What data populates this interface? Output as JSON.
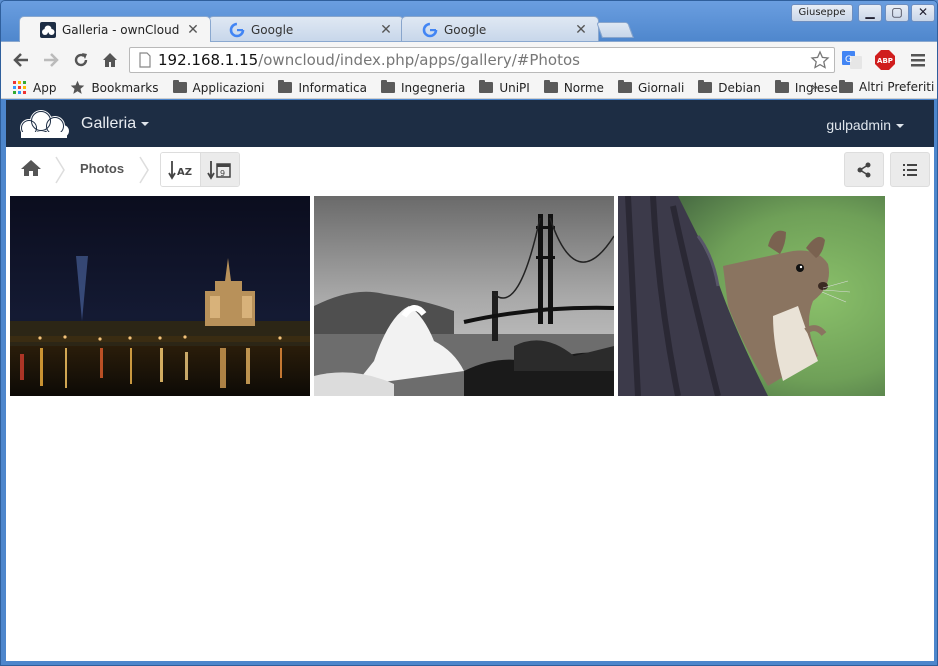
{
  "browser": {
    "tabs": [
      {
        "title": "Galleria - ownCloud",
        "active": true
      },
      {
        "title": "Google",
        "active": false
      },
      {
        "title": "Google",
        "active": false
      }
    ],
    "profile": "Giuseppe",
    "url_host": "192.168.1.15",
    "url_path": "/owncloud/index.php/apps/gallery/#Photos",
    "bookmarks": [
      "App",
      "Bookmarks",
      "Applicazioni",
      "Informatica",
      "Ingegneria",
      "UniPI",
      "Norme",
      "Giornali",
      "Debian",
      "Inglese"
    ],
    "bookmarks_more": "»",
    "other_bookmarks": "Altri Preferiti",
    "ext_abp": "ABP"
  },
  "app": {
    "name": "Galleria",
    "user": "gulpadmin",
    "breadcrumb": "Photos",
    "header_color": "#1d2d44"
  },
  "photos": [
    {
      "name": "notre-dame-night"
    },
    {
      "name": "golden-gate-bridge"
    },
    {
      "name": "squirrel"
    }
  ]
}
